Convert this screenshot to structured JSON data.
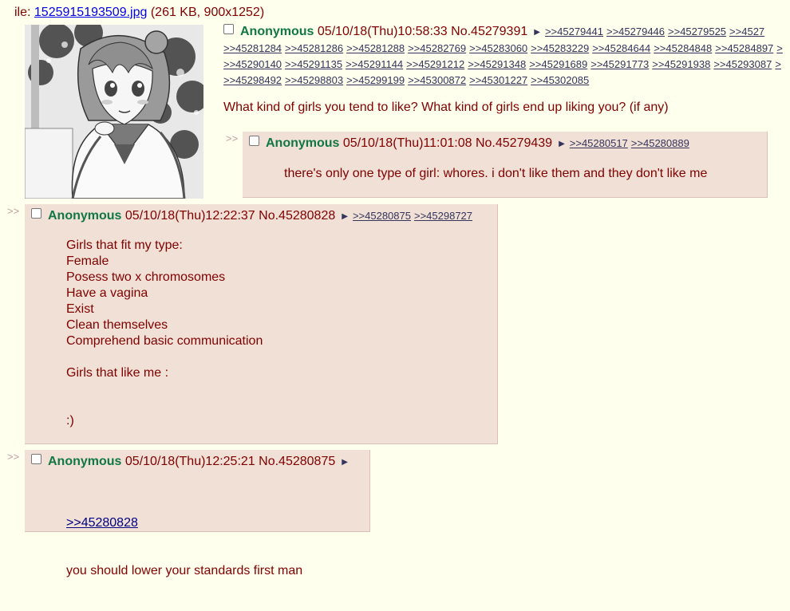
{
  "file": {
    "prefix": "ile: ",
    "name": "1525915193509.jpg",
    "meta": " (261 KB, 900x1252)"
  },
  "op": {
    "name": "Anonymous",
    "datetime": "05/10/18(Thu)10:58:33",
    "postnum": "No.45279391",
    "backlinks_row1": [
      ">>45279441",
      ">>45279446",
      ">>45279525",
      ">>4527"
    ],
    "backlinks_row2": [
      ">>45281284",
      ">>45281286",
      ">>45281288",
      ">>45282769",
      ">>45283060",
      ">>45283229",
      ">>45284644",
      ">>45284848",
      ">>45284897",
      ">"
    ],
    "backlinks_row3": [
      ">>45290140",
      ">>45291135",
      ">>45291144",
      ">>45291212",
      ">>45291348",
      ">>45291689",
      ">>45291773",
      ">>45291938",
      ">>45293087",
      ">"
    ],
    "backlinks_row4": [
      ">>45298492",
      ">>45298803",
      ">>45299199",
      ">>45300872",
      ">>45301227",
      ">>45302085"
    ],
    "message": "What kind of girls you tend to like? What kind of girls end up liking you? (if any)"
  },
  "reply_marker": ">>",
  "replies": [
    {
      "name": "Anonymous",
      "datetime": "05/10/18(Thu)11:01:08",
      "postnum": "No.45279439",
      "backlinks": [
        ">>45280517",
        ">>45280889"
      ],
      "message": "there's only one type of girl: whores. i don't like them and they don't like me"
    },
    {
      "name": "Anonymous",
      "datetime": "05/10/18(Thu)12:22:37",
      "postnum": "No.45280828",
      "backlinks": [
        ">>45280875",
        ">>45298727"
      ],
      "message_lines": [
        "Girls that fit my type:",
        "Female",
        "Posess two x chromosomes",
        "Have a vagina",
        "Exist",
        "Clean themselves",
        "Comprehend basic communication",
        "",
        "Girls that like me :",
        "",
        "",
        ":)"
      ]
    },
    {
      "name": "Anonymous",
      "datetime": "05/10/18(Thu)12:25:21",
      "postnum": "No.45280875",
      "backlinks": [],
      "quote": ">>45280828",
      "message": "you should lower your standards first man"
    }
  ],
  "colors": {
    "page_bg": "#ffffee",
    "reply_bg": "#f0e0d6",
    "name": "#117743",
    "text": "#800000",
    "link": "#34345c"
  }
}
